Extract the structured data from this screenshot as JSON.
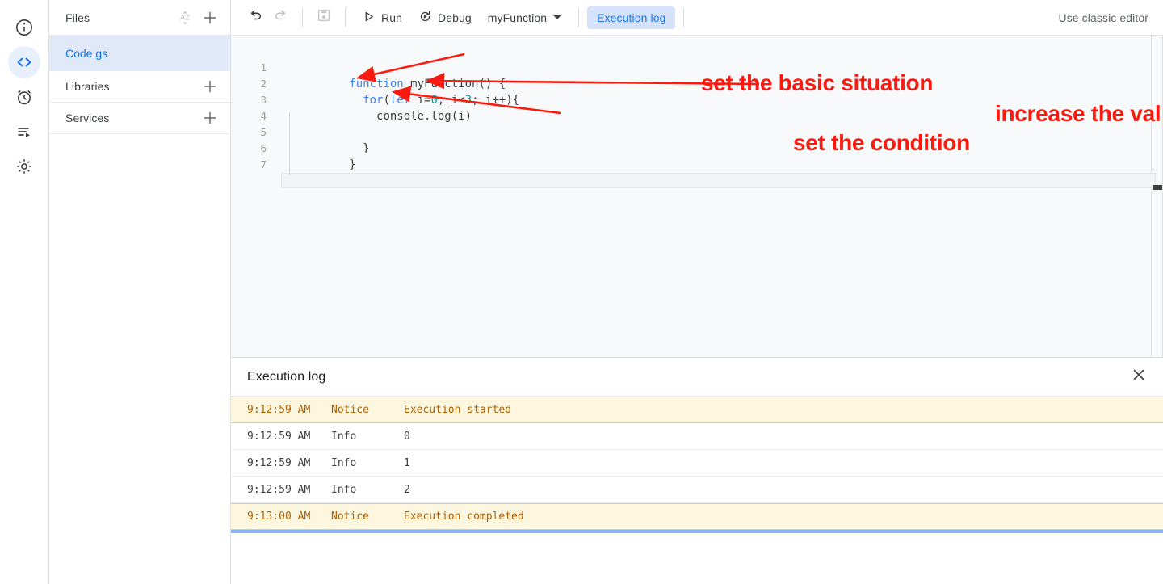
{
  "rail": {
    "items": [
      {
        "name": "overview-icon",
        "label": "Overview"
      },
      {
        "name": "editor-icon",
        "label": "Editor"
      },
      {
        "name": "triggers-icon",
        "label": "Triggers"
      },
      {
        "name": "executions-icon",
        "label": "Executions"
      },
      {
        "name": "settings-icon",
        "label": "Project Settings"
      }
    ],
    "active_index": 1
  },
  "sidebar": {
    "files_title": "Files",
    "sort_icon": "sort-az-icon",
    "add_icon": "plus-icon",
    "files": [
      {
        "name": "Code.gs",
        "selected": true
      }
    ],
    "sections": [
      {
        "title": "Libraries",
        "add_icon": "plus-icon"
      },
      {
        "title": "Services",
        "add_icon": "plus-icon"
      }
    ]
  },
  "toolbar": {
    "undo_icon": "undo-icon",
    "redo_icon": "redo-icon",
    "save_icon": "save-icon",
    "run_label": "Run",
    "run_icon": "play-icon",
    "debug_label": "Debug",
    "debug_icon": "debug-icon",
    "function_select": "myFunction",
    "function_caret": "chevron-down-icon",
    "execution_log_label": "Execution log",
    "classic_editor_label": "Use classic editor"
  },
  "editor": {
    "lines": [
      {
        "n": "1",
        "segments": [
          {
            "t": "function ",
            "c": "kw"
          },
          {
            "t": "myFunction() {",
            "c": "fn"
          }
        ]
      },
      {
        "n": "2",
        "segments": [
          {
            "t": "  ",
            "c": "fn"
          },
          {
            "t": "for",
            "c": "kw"
          },
          {
            "t": "(",
            "c": "fn"
          },
          {
            "t": "let ",
            "c": "kw"
          },
          {
            "t": "i=",
            "c": "und"
          },
          {
            "t": "0",
            "c": "num und"
          },
          {
            "t": "; ",
            "c": "fn"
          },
          {
            "t": "i<",
            "c": "und"
          },
          {
            "t": "3",
            "c": "num und"
          },
          {
            "t": "; ",
            "c": "fn"
          },
          {
            "t": "i++",
            "c": "und"
          },
          {
            "t": "){",
            "c": "fn"
          }
        ]
      },
      {
        "n": "3",
        "segments": [
          {
            "t": "    console.log(i)",
            "c": "fn"
          }
        ]
      },
      {
        "n": "4",
        "segments": [
          {
            "t": "",
            "c": "fn"
          }
        ]
      },
      {
        "n": "5",
        "segments": [
          {
            "t": "  }",
            "c": "fn"
          }
        ]
      },
      {
        "n": "6",
        "segments": [
          {
            "t": "}",
            "c": "fn"
          }
        ]
      },
      {
        "n": "7",
        "segments": [
          {
            "t": "",
            "c": "fn"
          }
        ]
      }
    ],
    "active_line": 7,
    "code_plain": "function myFunction() {\n  for(let i=0; i<3; i++){\n    console.log(i)\n\n  }\n}\n"
  },
  "annotations": {
    "color": "#fa1a0f",
    "items": [
      {
        "id": "anno-1",
        "text": "set the basic situation",
        "points_to": "i=0"
      },
      {
        "id": "anno-2",
        "text": "increase the value by one",
        "points_to": "i++"
      },
      {
        "id": "anno-3",
        "text": "set the condition",
        "points_to": "i<3"
      }
    ]
  },
  "log": {
    "title": "Execution log",
    "close_icon": "close-icon",
    "columns": [
      "time",
      "severity",
      "message"
    ],
    "rows": [
      {
        "time": "9:12:59 AM",
        "severity": "Notice",
        "message": "Execution started",
        "type": "notice"
      },
      {
        "time": "9:12:59 AM",
        "severity": "Info",
        "message": "0",
        "type": "info"
      },
      {
        "time": "9:12:59 AM",
        "severity": "Info",
        "message": "1",
        "type": "info"
      },
      {
        "time": "9:12:59 AM",
        "severity": "Info",
        "message": "2",
        "type": "info"
      },
      {
        "time": "9:13:00 AM",
        "severity": "Notice",
        "message": "Execution completed",
        "type": "notice"
      }
    ],
    "progress_color": "#8ab4f8"
  }
}
